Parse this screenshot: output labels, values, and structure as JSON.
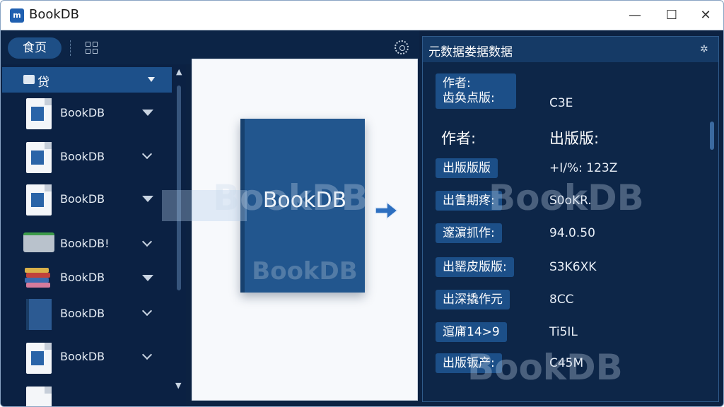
{
  "window": {
    "app_icon_text": "m",
    "title": "BookDB",
    "minimize": "—",
    "maximize": "☐",
    "close": "✕"
  },
  "toolbar": {
    "home_tab": "食页"
  },
  "sidebar": {
    "header_label": "贷",
    "items": [
      {
        "label": "BookDB",
        "chevron": "solid"
      },
      {
        "label": "BookDB",
        "chevron": "line"
      },
      {
        "label": "BookDB",
        "chevron": "solid"
      },
      {
        "label": "BookDB!",
        "chevron": "line"
      },
      {
        "label": "BookDB",
        "chevron": "solid"
      },
      {
        "label": "BookDB",
        "chevron": "line"
      },
      {
        "label": "BookDB",
        "chevron": "line"
      }
    ]
  },
  "preview": {
    "book_title": "BookDB",
    "book_watermark": "BookDB",
    "watermark_text": "BookDB"
  },
  "metadata": {
    "title": "元数据娄据数据",
    "first_label_line1": "作者:",
    "first_label_line2": "齿奂点版:",
    "first_value": "C3E",
    "heading_left": "作者:",
    "heading_right": "出版版:",
    "rows": [
      {
        "label": "出版版版",
        "value": "+I/%: 123Z"
      },
      {
        "label": "出眚期疼:",
        "value": "S0oKR."
      },
      {
        "label": "邃濵抓作:",
        "value": "94.0.50"
      },
      {
        "label": "出罂皮版版:",
        "value": "S3K6XK"
      },
      {
        "label": "出深撬作元",
        "value": "8CC"
      },
      {
        "label": "逭庯14>9",
        "value": "Ti5IL"
      },
      {
        "label": "出版钣产:",
        "value": "C45M"
      }
    ]
  },
  "colors": {
    "accent": "#1d508a",
    "panel_bg": "#0c2242",
    "label_bg": "#1c4f88"
  },
  "icons": [
    "app-icon",
    "grid-icon",
    "gear-icon",
    "folder-icon",
    "arrow-right-icon",
    "settings-icon",
    "chevron-down-icon"
  ]
}
